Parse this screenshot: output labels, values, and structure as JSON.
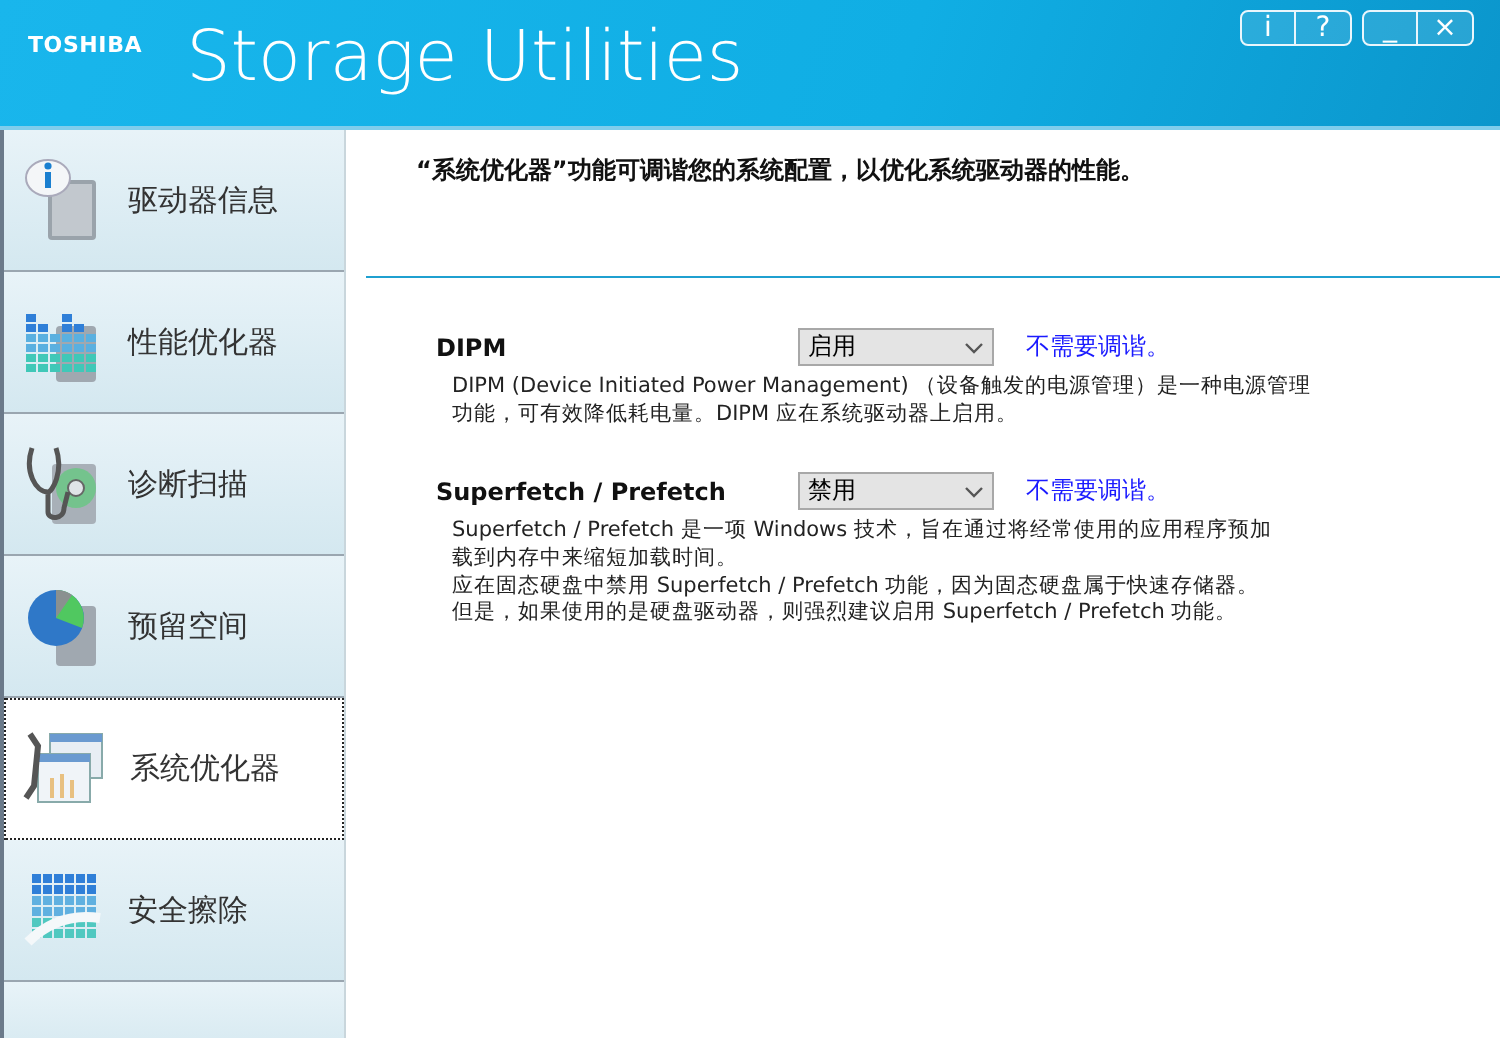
{
  "header": {
    "brand": "TOSHIBA",
    "title": "Storage Utilities",
    "window_buttons": [
      "i",
      "?",
      "_",
      "×"
    ]
  },
  "sidebar": {
    "items": [
      {
        "kind": "drive-info",
        "label": "驱动器信息",
        "selected": false
      },
      {
        "kind": "performance",
        "label": "性能优化器",
        "selected": false
      },
      {
        "kind": "diagnostic",
        "label": "诊断扫描",
        "selected": false
      },
      {
        "kind": "reserve",
        "label": "预留空间",
        "selected": false
      },
      {
        "kind": "optimizer",
        "label": "系统优化器",
        "selected": true
      },
      {
        "kind": "erase",
        "label": "安全擦除",
        "selected": false
      }
    ]
  },
  "content": {
    "intro": "“系统优化器”功能可调谐您的系统配置，以优化系统驱动器的性能。",
    "settings": [
      {
        "name": "DIPM",
        "value": "启用",
        "status": "不需要调谐。",
        "description": [
          "DIPM (Device Initiated Power Management) （设备触发的电源管理）是一种电源管理",
          "功能，可有效降低耗电量。DIPM 应在系统驱动器上启用。"
        ]
      },
      {
        "name": "Superfetch / Prefetch",
        "value": "禁用",
        "status": "不需要调谐。",
        "description": [
          "Superfetch / Prefetch 是一项 Windows 技术，旨在通过将经常使用的应用程序预加",
          "载到内存中来缩短加载时间。",
          "应在固态硬盘中禁用 Superfetch / Prefetch 功能，因为固态硬盘属于快速存储器。",
          "但是，如果使用的是硬盘驱动器，则强烈建议启用 Superfetch / Prefetch 功能。"
        ]
      }
    ]
  }
}
